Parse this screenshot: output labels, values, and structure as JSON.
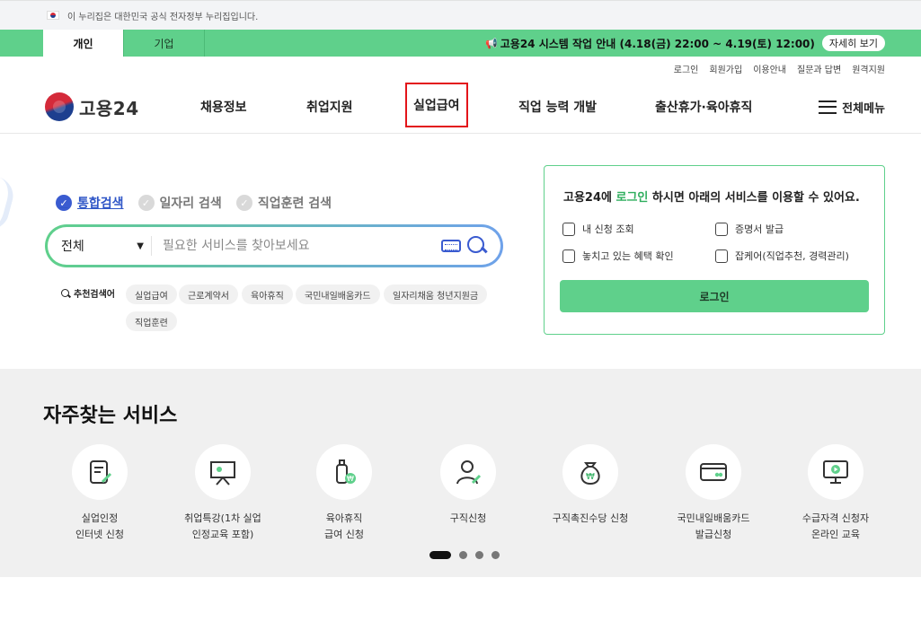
{
  "gov_bar": {
    "text": "이 누리집은 대한민국 공식 전자정부 누리집입니다."
  },
  "notice_bar": {
    "tabs": [
      "개인",
      "기업"
    ],
    "notice": "고용24 시스템 작업 안내 (4.18(금) 22:00 ~ 4.19(토) 12:00)",
    "more": "자세히 보기"
  },
  "util_links": [
    "로그인",
    "회원가입",
    "이용안내",
    "질문과 답변",
    "원격지원"
  ],
  "header": {
    "logo": "고용24",
    "nav": [
      "채용정보",
      "취업지원",
      "실업급여",
      "직업 능력 개발",
      "출산휴가·육아휴직"
    ],
    "all_menu": "전체메뉴"
  },
  "search": {
    "tabs": [
      "통합검색",
      "일자리 검색",
      "직업훈련 검색"
    ],
    "scope": "전체",
    "placeholder": "필요한 서비스를 찾아보세요",
    "rec_label": "추천검색어",
    "chips": [
      "실업급여",
      "근로계약서",
      "육아휴직",
      "국민내일배움카드",
      "일자리채움 청년지원금",
      "직업훈련"
    ]
  },
  "login_panel": {
    "title_pre": "고용24에 ",
    "title_hl": "로그인",
    "title_post": " 하시면 아래의 서비스를 이용할 수 있어요.",
    "services": [
      "내 신청 조회",
      "증명서 발급",
      "놓치고 있는 혜택 확인",
      "잡케어(직업추천, 경력관리)"
    ],
    "button": "로그인"
  },
  "frequent": {
    "title": "자주찾는 서비스",
    "items": [
      {
        "label": "실업인정\n인터넷 신청",
        "icon": "document-pen-icon"
      },
      {
        "label": "취업특강(1차 실업\n인정교육 포함)",
        "icon": "presentation-board-icon"
      },
      {
        "label": "육아휴직\n급여 신청",
        "icon": "baby-bottle-won-icon"
      },
      {
        "label": "구직신청",
        "icon": "person-pen-icon"
      },
      {
        "label": "구직촉진수당 신청",
        "icon": "money-bag-won-icon"
      },
      {
        "label": "국민내일배움카드\n발급신청",
        "icon": "card-icon"
      },
      {
        "label": "수급자격 신청자\n온라인 교육",
        "icon": "monitor-play-icon"
      }
    ],
    "pagination_count": 4,
    "active_page": 1
  },
  "colors": {
    "green": "#5fd08b",
    "blue": "#3a5bd0",
    "red_box": "#e3141a"
  }
}
